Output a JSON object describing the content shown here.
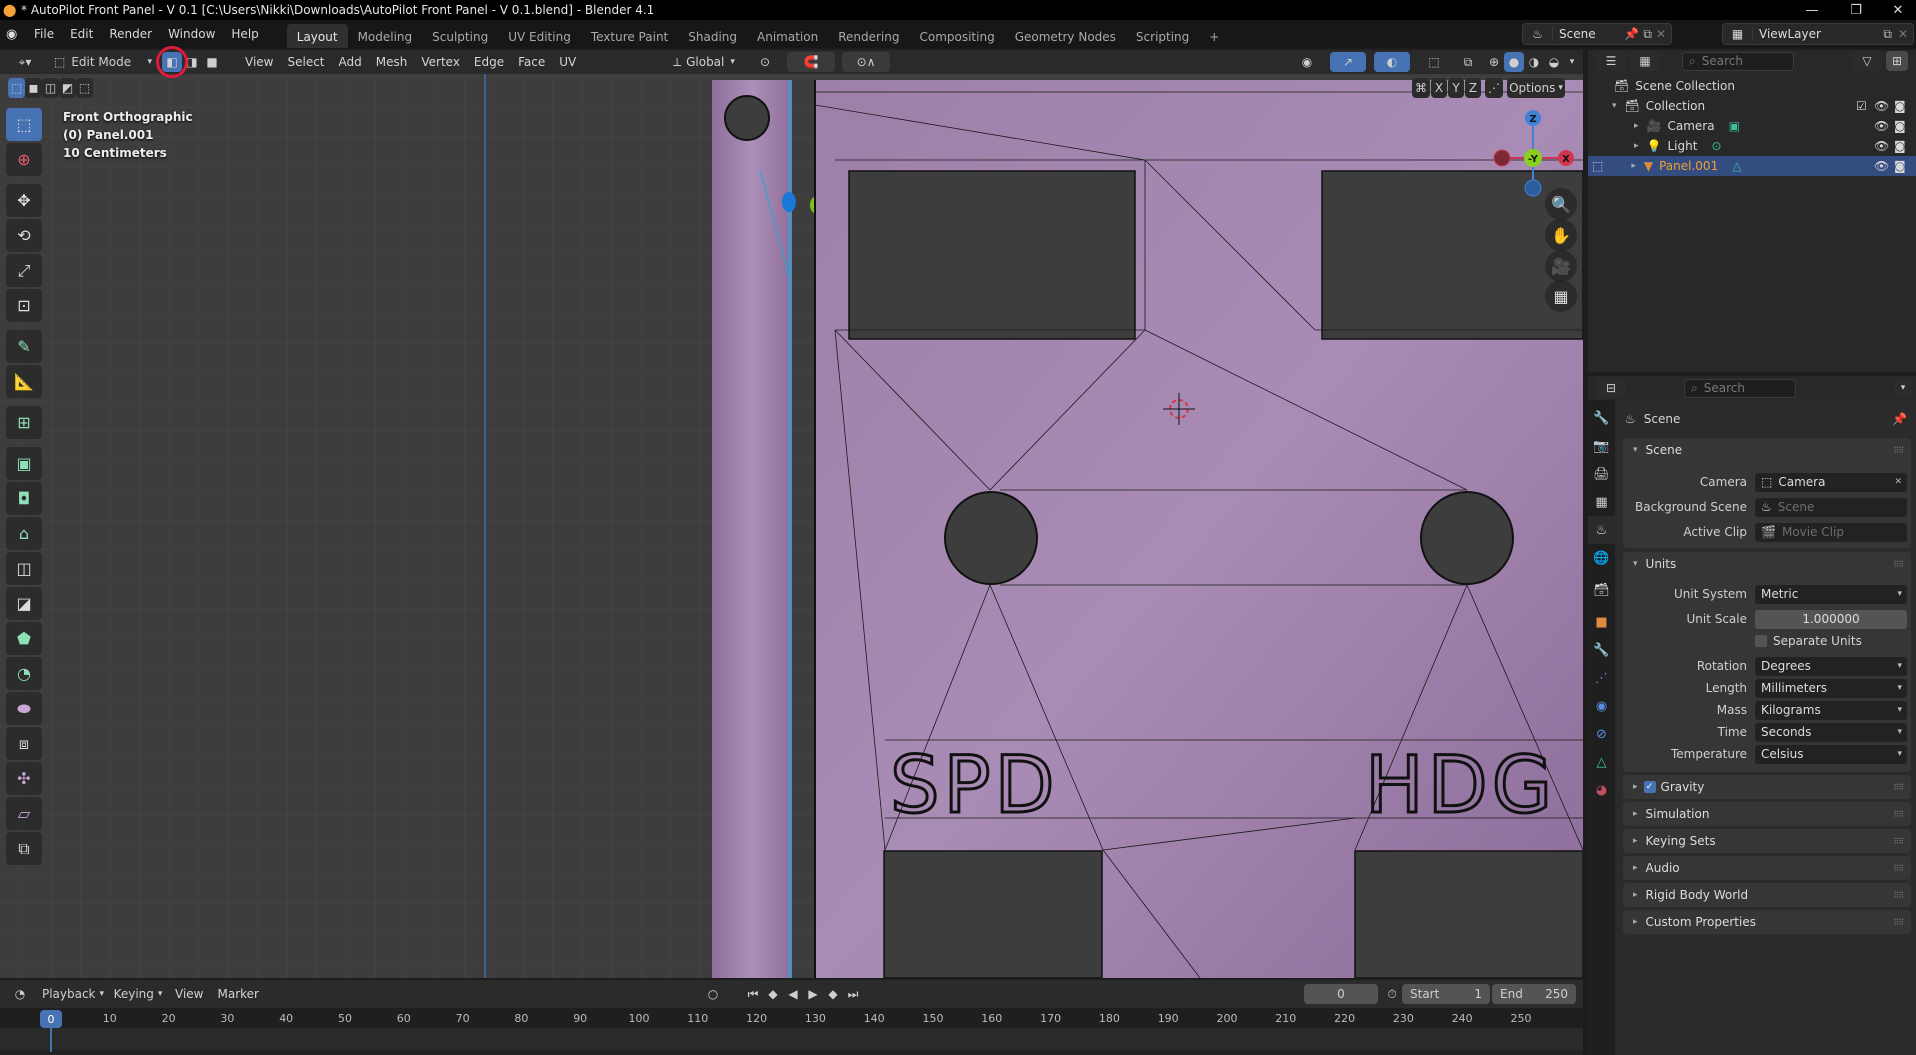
{
  "window": {
    "title": "* AutoPilot Front Panel - V 0.1 [C:\\Users\\Nikki\\Downloads\\AutoPilot Front Panel - V 0.1.blend] - Blender 4.1",
    "minimize": "—",
    "maximize": "❐",
    "close": "✕"
  },
  "menu": [
    "File",
    "Edit",
    "Render",
    "Window",
    "Help"
  ],
  "workspaces": [
    "Layout",
    "Modeling",
    "Sculpting",
    "UV Editing",
    "Texture Paint",
    "Shading",
    "Animation",
    "Rendering",
    "Compositing",
    "Geometry Nodes",
    "Scripting"
  ],
  "workspace_add": "+",
  "active_workspace": "Layout",
  "scene_selector": {
    "value": "Scene"
  },
  "viewlayer_selector": {
    "value": "ViewLayer"
  },
  "viewport_header": {
    "mode": "Edit Mode",
    "select_modes": [
      "vertex",
      "edge",
      "face"
    ],
    "active_select_mode": "vertex",
    "menus": [
      "View",
      "Select",
      "Add",
      "Mesh",
      "Vertex",
      "Edge",
      "Face",
      "UV"
    ],
    "transform_orientation": "Global",
    "options_label": "Options",
    "axis_toggles": [
      "X",
      "Y",
      "Z"
    ]
  },
  "viewport_info": {
    "view": "Front Orthographic",
    "object": "(0) Panel.001",
    "scale": "10 Centimeters"
  },
  "mesh_text": [
    "SPD",
    "HDG"
  ],
  "gizmo": {
    "z": "Z",
    "y": "-Y",
    "x": "X"
  },
  "tools": [
    "select-box",
    "cursor",
    "move",
    "rotate",
    "scale",
    "transform",
    "annotate",
    "measure",
    "add-cube",
    "extrude-region",
    "inset-faces",
    "bevel",
    "loop-cut",
    "knife",
    "poly-build",
    "spin",
    "smooth",
    "edge-slide",
    "shrink-fatten",
    "shear",
    "rip-region"
  ],
  "outliner": {
    "search_placeholder": "Search",
    "items": [
      {
        "label": "Scene Collection",
        "depth": 0
      },
      {
        "label": "Collection",
        "depth": 1
      },
      {
        "label": "Camera",
        "depth": 2
      },
      {
        "label": "Light",
        "depth": 2
      },
      {
        "label": "Panel.001",
        "depth": 2,
        "selected": true
      }
    ]
  },
  "properties": {
    "search_placeholder": "Search",
    "context_title": "Scene",
    "scene_panel": {
      "title": "Scene",
      "camera_label": "Camera",
      "camera_value": "Camera",
      "background_label": "Background Scene",
      "background_placeholder": "Scene",
      "clip_label": "Active Clip",
      "clip_placeholder": "Movie Clip"
    },
    "units_panel": {
      "title": "Units",
      "unit_system_label": "Unit System",
      "unit_system": "Metric",
      "unit_scale_label": "Unit Scale",
      "unit_scale": "1.000000",
      "separate_units_label": "Separate Units",
      "separate_units": false,
      "rotation_label": "Rotation",
      "rotation": "Degrees",
      "length_label": "Length",
      "length": "Millimeters",
      "mass_label": "Mass",
      "mass": "Kilograms",
      "time_label": "Time",
      "time": "Seconds",
      "temperature_label": "Temperature",
      "temperature": "Celsius"
    },
    "collapsed_panels": [
      {
        "title": "Gravity",
        "checkbox": true
      },
      {
        "title": "Simulation"
      },
      {
        "title": "Keying Sets"
      },
      {
        "title": "Audio"
      },
      {
        "title": "Rigid Body World"
      },
      {
        "title": "Custom Properties"
      }
    ]
  },
  "timeline": {
    "menus": [
      "Playback",
      "Keying",
      "View",
      "Marker"
    ],
    "current_frame": "0",
    "start_label": "Start",
    "start": "1",
    "end_label": "End",
    "end": "250",
    "ticks": [
      "0",
      "10",
      "20",
      "30",
      "40",
      "50",
      "60",
      "70",
      "80",
      "90",
      "100",
      "110",
      "120",
      "130",
      "140",
      "150",
      "160",
      "170",
      "180",
      "190",
      "200",
      "210",
      "220",
      "230",
      "240",
      "250"
    ]
  },
  "colors": {
    "accent": "#4772b3",
    "mesh": "#9a7aa6",
    "selected_edge": "#1fa8e0",
    "highlight_circle": "#e01a3a",
    "outliner_selected_text": "#f0a030"
  }
}
